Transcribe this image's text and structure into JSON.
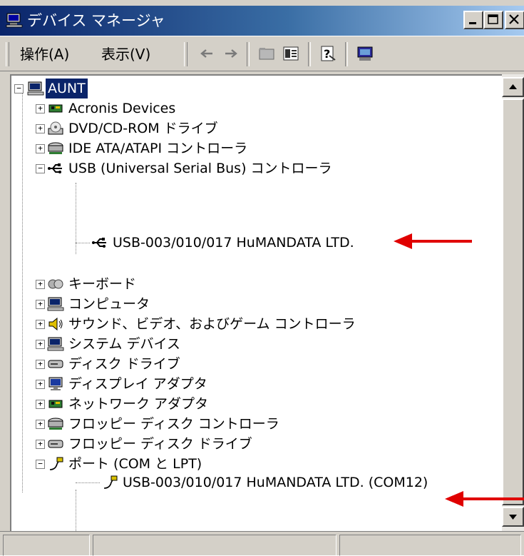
{
  "window": {
    "title": "デバイス マネージャ"
  },
  "toolbar": {
    "menu": [
      {
        "label": "操作(A)"
      },
      {
        "label": "表示(V)"
      }
    ],
    "icons": [
      "back-arrow-icon",
      "forward-arrow-icon",
      "folder-up-icon",
      "properties-icon",
      "help-icon",
      "computer-scan-icon"
    ]
  },
  "tree": {
    "root": {
      "label": "AUNT",
      "expanded": true,
      "selected": true,
      "icon": "computer-icon"
    },
    "items": [
      {
        "label": "Acronis Devices",
        "icon": "board-icon",
        "expanded": false
      },
      {
        "label": "DVD/CD-ROM ドライブ",
        "icon": "dvd-drive-icon",
        "expanded": false
      },
      {
        "label": "IDE ATA/ATAPI コントローラ",
        "icon": "ide-controller-icon",
        "expanded": false
      },
      {
        "label": "USB (Universal Serial Bus) コントローラ",
        "icon": "usb-icon",
        "expanded": true,
        "children": [
          {
            "label": "USB-003/010/017 HuMANDATA LTD.",
            "icon": "usb-icon"
          }
        ]
      },
      {
        "label": "キーボード",
        "icon": "keyboard-icon",
        "expanded": false
      },
      {
        "label": "コンピュータ",
        "icon": "computer-icon",
        "expanded": false
      },
      {
        "label": "サウンド、ビデオ、およびゲーム コントローラ",
        "icon": "speaker-icon",
        "expanded": false
      },
      {
        "label": "システム デバイス",
        "icon": "computer-icon",
        "expanded": false
      },
      {
        "label": "ディスク ドライブ",
        "icon": "disk-drive-icon",
        "expanded": false
      },
      {
        "label": "ディスプレイ アダプタ",
        "icon": "monitor-icon",
        "expanded": false
      },
      {
        "label": "ネットワーク アダプタ",
        "icon": "network-card-icon",
        "expanded": false
      },
      {
        "label": "フロッピー ディスク コントローラ",
        "icon": "floppy-controller-icon",
        "expanded": false
      },
      {
        "label": "フロッピー ディスク ドライブ",
        "icon": "floppy-drive-icon",
        "expanded": false
      },
      {
        "label": "ポート (COM と LPT)",
        "icon": "port-icon",
        "expanded": true,
        "children": [
          {
            "label": "USB-003/010/017 HuMANDATA LTD. (COM12)",
            "icon": "port-icon"
          }
        ]
      }
    ]
  },
  "annotations": {
    "arrow_color": "#e00000"
  },
  "colors": {
    "title_bar_start": "#0a246a",
    "title_bar_end": "#a6caf0",
    "window_face": "#d4d0c8",
    "selection": "#0a246a"
  }
}
